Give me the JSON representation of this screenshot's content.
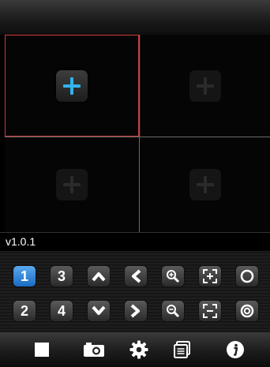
{
  "version": "v1.0.1",
  "colors": {
    "accent": "#33b2ee",
    "selection_border": "#cc3b3b",
    "selected_button": "#2f86da"
  },
  "grid": {
    "cells": [
      {
        "icon": "add-camera-icon",
        "state": "active"
      },
      {
        "icon": "add-camera-icon",
        "state": "dim"
      },
      {
        "icon": "add-camera-icon",
        "state": "dim"
      },
      {
        "icon": "add-camera-icon",
        "state": "dim"
      }
    ]
  },
  "controls": {
    "row1": [
      {
        "label": "1",
        "selected": true
      },
      {
        "label": "3"
      },
      {
        "icon": "chevron-up-icon"
      },
      {
        "icon": "chevron-left-icon"
      },
      {
        "icon": "zoom-in-icon"
      },
      {
        "icon": "focus-near-icon"
      },
      {
        "icon": "iris-open-icon"
      }
    ],
    "row2": [
      {
        "label": "2"
      },
      {
        "label": "4"
      },
      {
        "icon": "chevron-down-icon"
      },
      {
        "icon": "chevron-right-icon"
      },
      {
        "icon": "zoom-out-icon"
      },
      {
        "icon": "focus-far-icon"
      },
      {
        "icon": "iris-close-icon"
      }
    ]
  },
  "tabbar": {
    "items": [
      "stop-icon",
      "snapshot-camera-icon",
      "settings-gear-icon",
      "playback-list-icon",
      "info-icon"
    ]
  }
}
